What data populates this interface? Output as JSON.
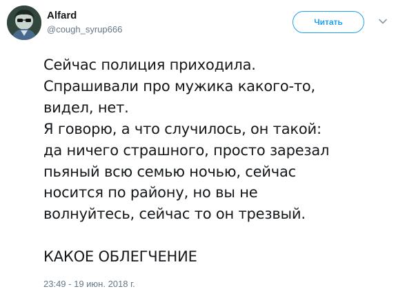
{
  "author": {
    "display_name": "Alfard",
    "handle": "@cough_syrup666",
    "avatar_icon": "anime-avatar"
  },
  "follow_button": {
    "label": "Читать",
    "color": "#1da1f2"
  },
  "more_menu_icon": "chevron-down-icon",
  "tweet": {
    "lines": [
      "Сейчас полиция приходила.",
      "Спрашивали про мужика какого-то,",
      "видел, нет.",
      "Я говорю, а что случилось, он такой:",
      "да ничего страшного, просто зарезал",
      "пьяный всю семью ночью, сейчас",
      "носится по району, но вы не",
      "волнуйтесь, сейчас то он трезвый."
    ],
    "closing_line": "КАКОЕ ОБЛЕГЧЕНИЕ"
  },
  "timestamp": "23:49 - 19 июн. 2018 г."
}
